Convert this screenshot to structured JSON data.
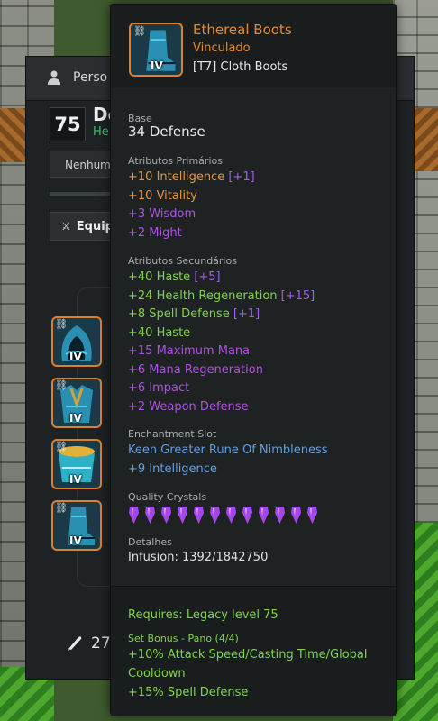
{
  "panel": {
    "title": "Perso",
    "level": "75",
    "name": "Do",
    "subtitle": "He",
    "select_value": "Nenhum",
    "equip_tab": "Equipa",
    "pen_value": "27"
  },
  "slots": [
    {
      "tier": "IV",
      "icon": "hood-icon"
    },
    {
      "tier": "IV",
      "icon": "robe-icon"
    },
    {
      "tier": "IV",
      "icon": "belt-icon"
    },
    {
      "tier": "IV",
      "icon": "boots-icon"
    }
  ],
  "tooltip": {
    "name": "Ethereal Boots",
    "bound": "Vinculado",
    "type": "[T7] Cloth Boots",
    "tier": "IV",
    "base_label": "Base",
    "base_value": "34 Defense",
    "primary_label": "Atributos Primários",
    "primary": [
      {
        "text": "+10 Intelligence",
        "bonus": "[+1]",
        "color": "#e89540"
      },
      {
        "text": "+10 Vitality",
        "bonus": "",
        "color": "#e89540"
      },
      {
        "text": "+3 Wisdom",
        "bonus": "",
        "color": "#b24fe6"
      },
      {
        "text": "+2 Might",
        "bonus": "",
        "color": "#b24fe6"
      }
    ],
    "secondary_label": "Atributos Secundários",
    "secondary": [
      {
        "text": "+40 Haste",
        "bonus": "[+5]",
        "color": "#7fd44c"
      },
      {
        "text": "+24 Health Regeneration",
        "bonus": "[+15]",
        "color": "#7fd44c"
      },
      {
        "text": "+8 Spell Defense",
        "bonus": "[+1]",
        "color": "#7fd44c"
      },
      {
        "text": "+40 Haste",
        "bonus": "",
        "color": "#7fd44c"
      },
      {
        "text": "+15 Maximum Mana",
        "bonus": "",
        "color": "#b24fe6"
      },
      {
        "text": "+6 Mana Regeneration",
        "bonus": "",
        "color": "#b24fe6"
      },
      {
        "text": "+6 Impact",
        "bonus": "",
        "color": "#b24fe6"
      },
      {
        "text": "+2 Weapon Defense",
        "bonus": "",
        "color": "#b24fe6"
      }
    ],
    "enchant_label": "Enchantment Slot",
    "enchant_name": "Keen Greater Rune Of Nimbleness",
    "enchant_bonus": "+9 Intelligence",
    "crystals_label": "Quality Crystals",
    "crystal_count": 12,
    "details_label": "Detalhes",
    "infusion": "Infusion: 1392/1842750",
    "requires": "Requires: Legacy level 75",
    "set_label": "Set Bonus - Pano (4/4)",
    "set_bonus_1a": "+10% Attack Speed/Casting Time/Global",
    "set_bonus_1b": "Cooldown",
    "set_bonus_2": "+15% Spell Defense"
  },
  "colors": {
    "legendary": "#e58a2e",
    "primary_bonus": "#a25cf0",
    "green_stat": "#7fd44c",
    "purple_stat": "#b24fe6",
    "enchant": "#5f9fe6",
    "crystal": "#a347e8"
  }
}
